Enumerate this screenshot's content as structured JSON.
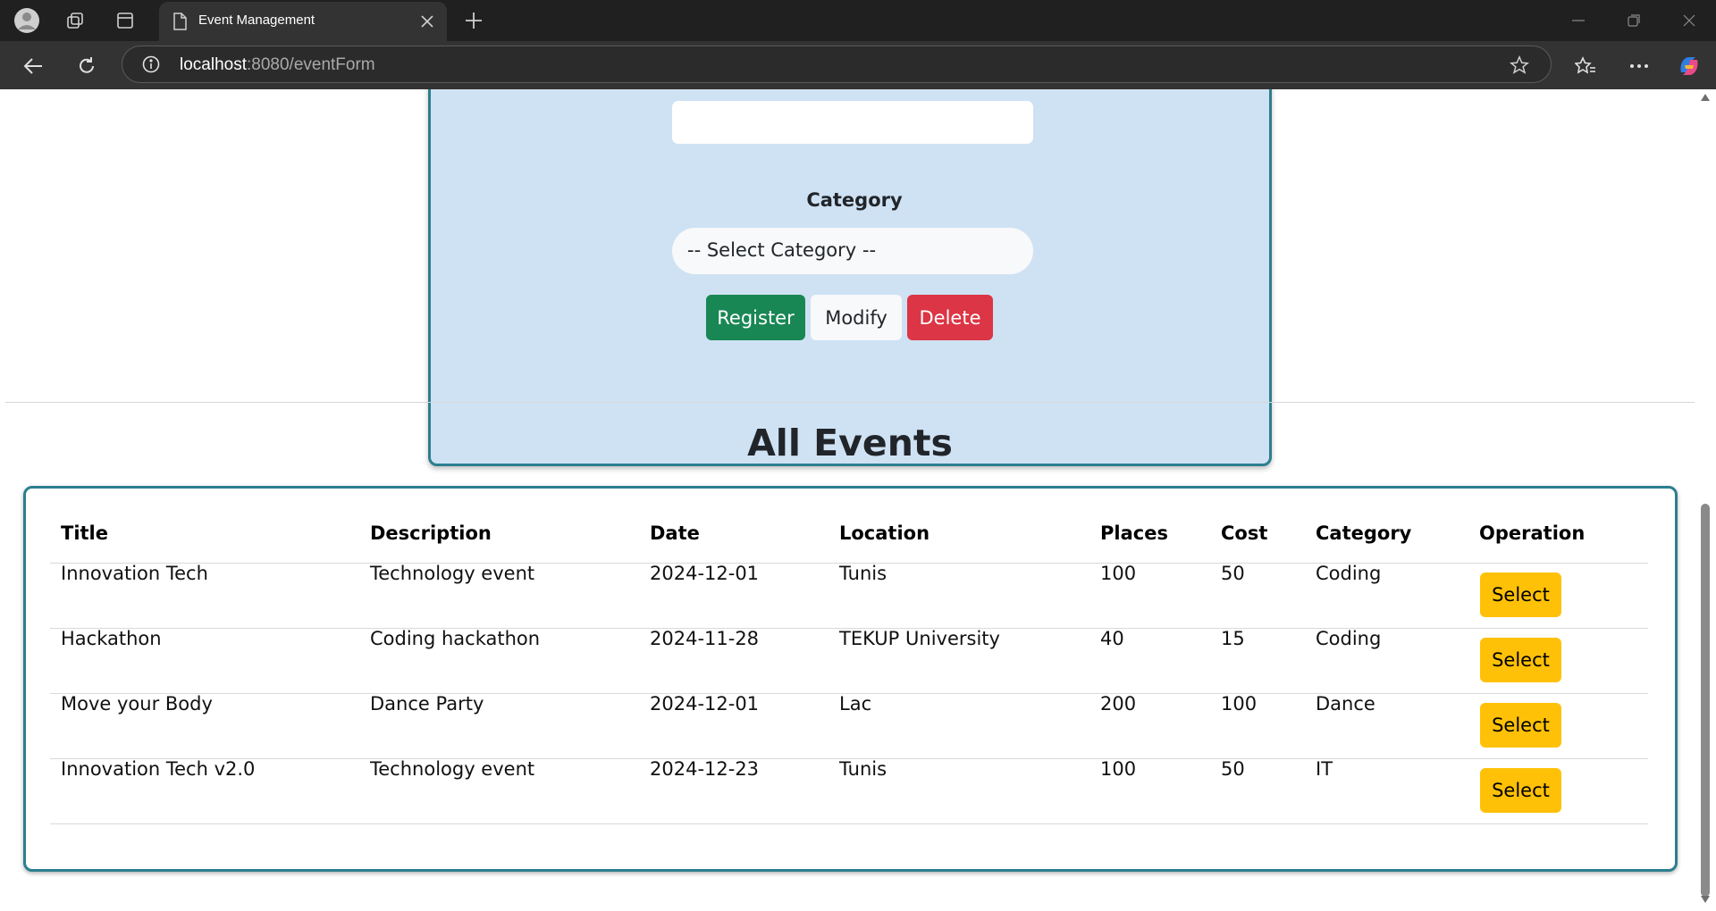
{
  "browser": {
    "tab_title": "Event Management",
    "url_host": "localhost",
    "url_rest": ":8080/eventForm"
  },
  "form": {
    "category_label": "Category",
    "category_select": "-- Select Category --",
    "register_label": "Register",
    "modify_label": "Modify",
    "delete_label": "Delete"
  },
  "events": {
    "heading": "All Events",
    "columns": [
      "Title",
      "Description",
      "Date",
      "Location",
      "Places",
      "Cost",
      "Category",
      "Operation"
    ],
    "rows": [
      {
        "title": "Innovation Tech",
        "description": "Technology event",
        "date": "2024-12-01",
        "location": "Tunis",
        "places": "100",
        "cost": "50",
        "category": "Coding",
        "action": "Select"
      },
      {
        "title": "Hackathon",
        "description": "Coding hackathon",
        "date": "2024-11-28",
        "location": "TEKUP University",
        "places": "40",
        "cost": "15",
        "category": "Coding",
        "action": "Select"
      },
      {
        "title": "Move your Body",
        "description": "Dance Party",
        "date": "2024-12-01",
        "location": "Lac",
        "places": "200",
        "cost": "100",
        "category": "Dance",
        "action": "Select"
      },
      {
        "title": "Innovation Tech v2.0",
        "description": "Technology event",
        "date": "2024-12-23",
        "location": "Tunis",
        "places": "100",
        "cost": "50",
        "category": "IT",
        "action": "Select"
      }
    ]
  },
  "colors": {
    "form_bg": "#cfe2f4",
    "card_border": "#2b7f8f",
    "register": "#198754",
    "delete": "#dc3545",
    "select": "#ffc107"
  }
}
